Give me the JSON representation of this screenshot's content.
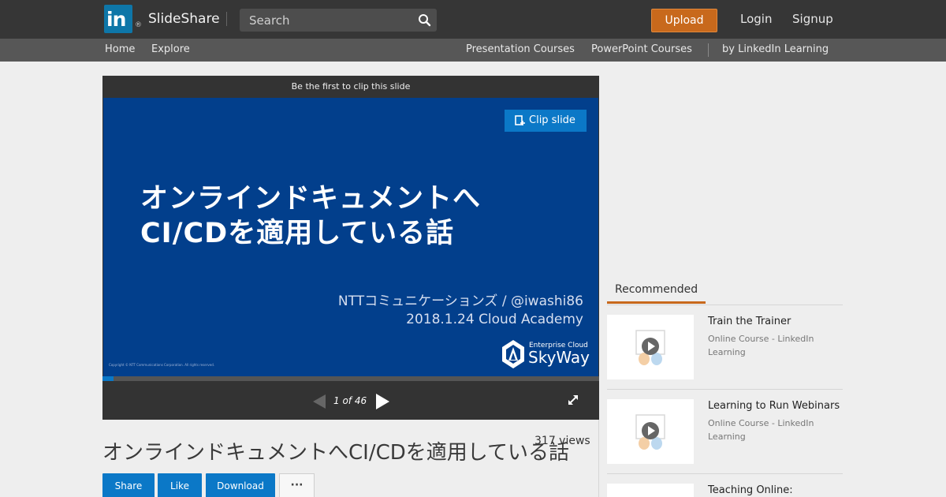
{
  "header": {
    "logo_text": "SlideShare",
    "logo_mark": "in",
    "logo_reg": "®",
    "search_placeholder": "Search",
    "upload_label": "Upload",
    "login_label": "Login",
    "signup_label": "Signup"
  },
  "subnav": {
    "home": "Home",
    "explore": "Explore",
    "presentation_courses": "Presentation Courses",
    "powerpoint_courses": "PowerPoint Courses",
    "linkedin_learning": "by LinkedIn Learning"
  },
  "player": {
    "clip_banner": "Be the first to clip this slide",
    "clip_button": "Clip slide",
    "slide_title_line1": "オンラインドキュメントへ",
    "slide_title_line2": "CI/CDを適用している話",
    "slide_author": "NTTコミュニケーションズ / @iwashi86",
    "slide_event": "2018.1.24 Cloud Academy",
    "slide_copyright": "Copyright © NTT Communications Corporation. All rights reserved.",
    "logo_sub": "Enterprise Cloud",
    "logo_name": "SkyWay",
    "page_indicator": "1 of 46",
    "current_slide": 1,
    "total_slides": 46
  },
  "presentation": {
    "title": "オンラインドキュメントへCI/CDを適用している話",
    "views": "317 views",
    "share_label": "Share",
    "like_label": "Like",
    "download_label": "Download",
    "more_label": "···"
  },
  "sidebar": {
    "tab_label": "Recommended",
    "items": [
      {
        "title": "Train the Trainer",
        "subtitle": "Online Course - LinkedIn Learning"
      },
      {
        "title": "Learning to Run Webinars",
        "subtitle": "Online Course - LinkedIn Learning"
      },
      {
        "title": "Teaching Online:",
        "subtitle": ""
      }
    ]
  },
  "colors": {
    "topbar": "#363636",
    "subnav": "#575757",
    "upload": "#c8691c",
    "accent_blue": "#0b78c7",
    "slide_bg": "#023f8c"
  }
}
